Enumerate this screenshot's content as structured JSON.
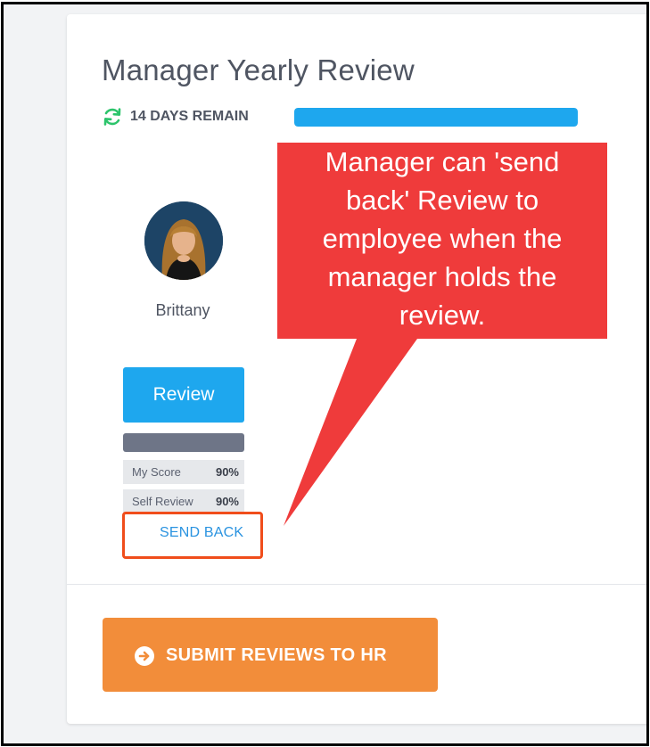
{
  "review": {
    "title": "Manager Yearly Review",
    "days_remaining_label": "14 DAYS REMAIN",
    "progress_fraction": 1.0
  },
  "employee": {
    "name": "Brittany",
    "review_button_label": "Review",
    "scores": [
      {
        "label": "My Score",
        "value": "90%"
      },
      {
        "label": "Self Review",
        "value": "90%"
      }
    ],
    "send_back_label": "SEND BACK"
  },
  "footer": {
    "submit_label": "SUBMIT REVIEWS TO HR"
  },
  "annotation": {
    "lines": [
      "Manager can 'send",
      "back' Review to",
      "employee when the",
      "manager holds the",
      "review."
    ]
  },
  "colors": {
    "accent_blue": "#1ea7ee",
    "refresh_green": "#2cc46b",
    "submit_orange": "#f28d3a",
    "callout_red": "#ef3b3b",
    "highlight_orange": "#f04d1b"
  }
}
